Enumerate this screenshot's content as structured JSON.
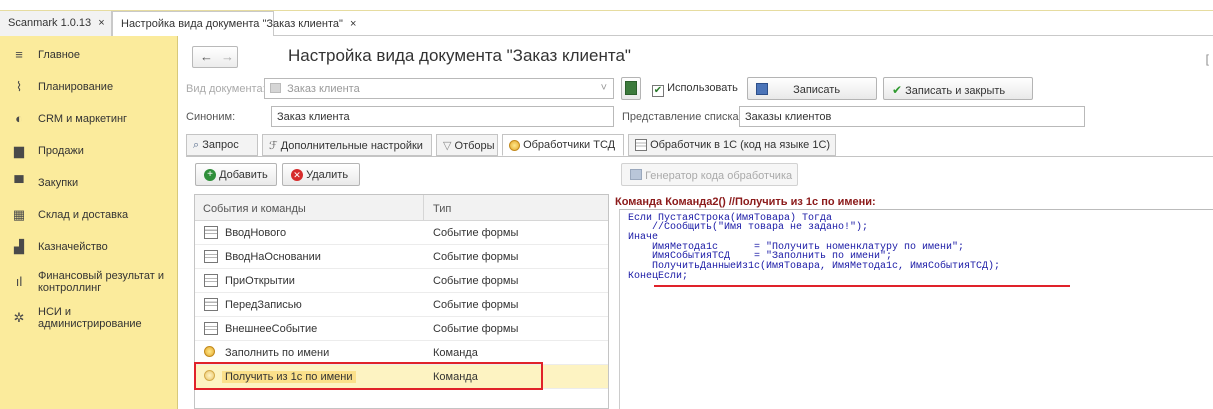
{
  "tabs": [
    {
      "label": "Scanmark 1.0.13",
      "close": "×"
    },
    {
      "label": "Настройка вида документа \"Заказ клиента\"",
      "close": "×"
    }
  ],
  "sidebar": {
    "items": [
      {
        "label": "Главное",
        "icon": "menu-icon"
      },
      {
        "label": "Планирование",
        "icon": "chart-icon"
      },
      {
        "label": "CRM и маркетинг",
        "icon": "crm-icon"
      },
      {
        "label": "Продажи",
        "icon": "sales-icon"
      },
      {
        "label": "Закупки",
        "icon": "cart-icon"
      },
      {
        "label": "Склад и доставка",
        "icon": "warehouse-icon"
      },
      {
        "label": "Казначейство",
        "icon": "treasury-icon"
      },
      {
        "label": "Финансовый результат и контроллинг",
        "icon": "finance-icon"
      },
      {
        "label": "НСИ и администрирование",
        "icon": "gear-icon"
      }
    ]
  },
  "header": {
    "back": "←",
    "forward": "→",
    "title": "Настройка вида документа \"Заказ клиента\""
  },
  "form": {
    "doc_type_label": "Вид документа:",
    "doc_type_value": "Заказ клиента",
    "use_label": "Использовать",
    "save_label": "Записать",
    "save_close_label": "Записать и закрыть",
    "synonym_label": "Синоним:",
    "synonym_value": "Заказ клиента",
    "list_label": "Представление списка:",
    "list_value": "Заказы клиентов"
  },
  "form_tabs": [
    "Запрос",
    "Дополнительные настройки",
    "Отборы",
    "Обработчики ТСД",
    "Обработчик в 1С (код на языке 1С)"
  ],
  "toolbar": {
    "add_label": "Добавить",
    "delete_label": "Удалить",
    "generator_label": "Генератор кода обработчика"
  },
  "table": {
    "col_events": "События и команды",
    "col_type": "Тип",
    "rows": [
      {
        "name": "ВводНового",
        "type": "Событие формы",
        "kind": "event"
      },
      {
        "name": "ВводНаОсновании",
        "type": "Событие формы",
        "kind": "event"
      },
      {
        "name": "ПриОткрытии",
        "type": "Событие формы",
        "kind": "event"
      },
      {
        "name": "ПередЗаписью",
        "type": "Событие формы",
        "kind": "event"
      },
      {
        "name": "ВнешнееСобытие",
        "type": "Событие формы",
        "kind": "event"
      },
      {
        "name": "Заполнить по имени",
        "type": "Команда",
        "kind": "command"
      },
      {
        "name": "Получить из 1с по имени",
        "type": "Команда",
        "kind": "command"
      }
    ]
  },
  "code": {
    "title": "Команда Команда2() //Получить из 1с по имени:",
    "lines": [
      "Если ПустаяСтрока(ИмяТовара) Тогда",
      "    //Сообщить(\"Имя товара не задано!\");",
      "Иначе",
      "    ИмяМетода1с      = \"Получить номенклатуру по имени\";",
      "    ИмяСобытияТСД    = \"Заполнить по имени\";",
      "    ПолучитьДанныеИз1с(ИмяТовара, ИмяМетода1с, ИмяСобытияТСД);",
      "КонецЕсли;"
    ]
  },
  "colors": {
    "sidebar_bg": "#fbeb9c",
    "selection_bg": "#fdf3c2",
    "highlight_red": "#e0222a",
    "code_blue": "#1a1aa6",
    "title_red": "#8b1a1a"
  }
}
